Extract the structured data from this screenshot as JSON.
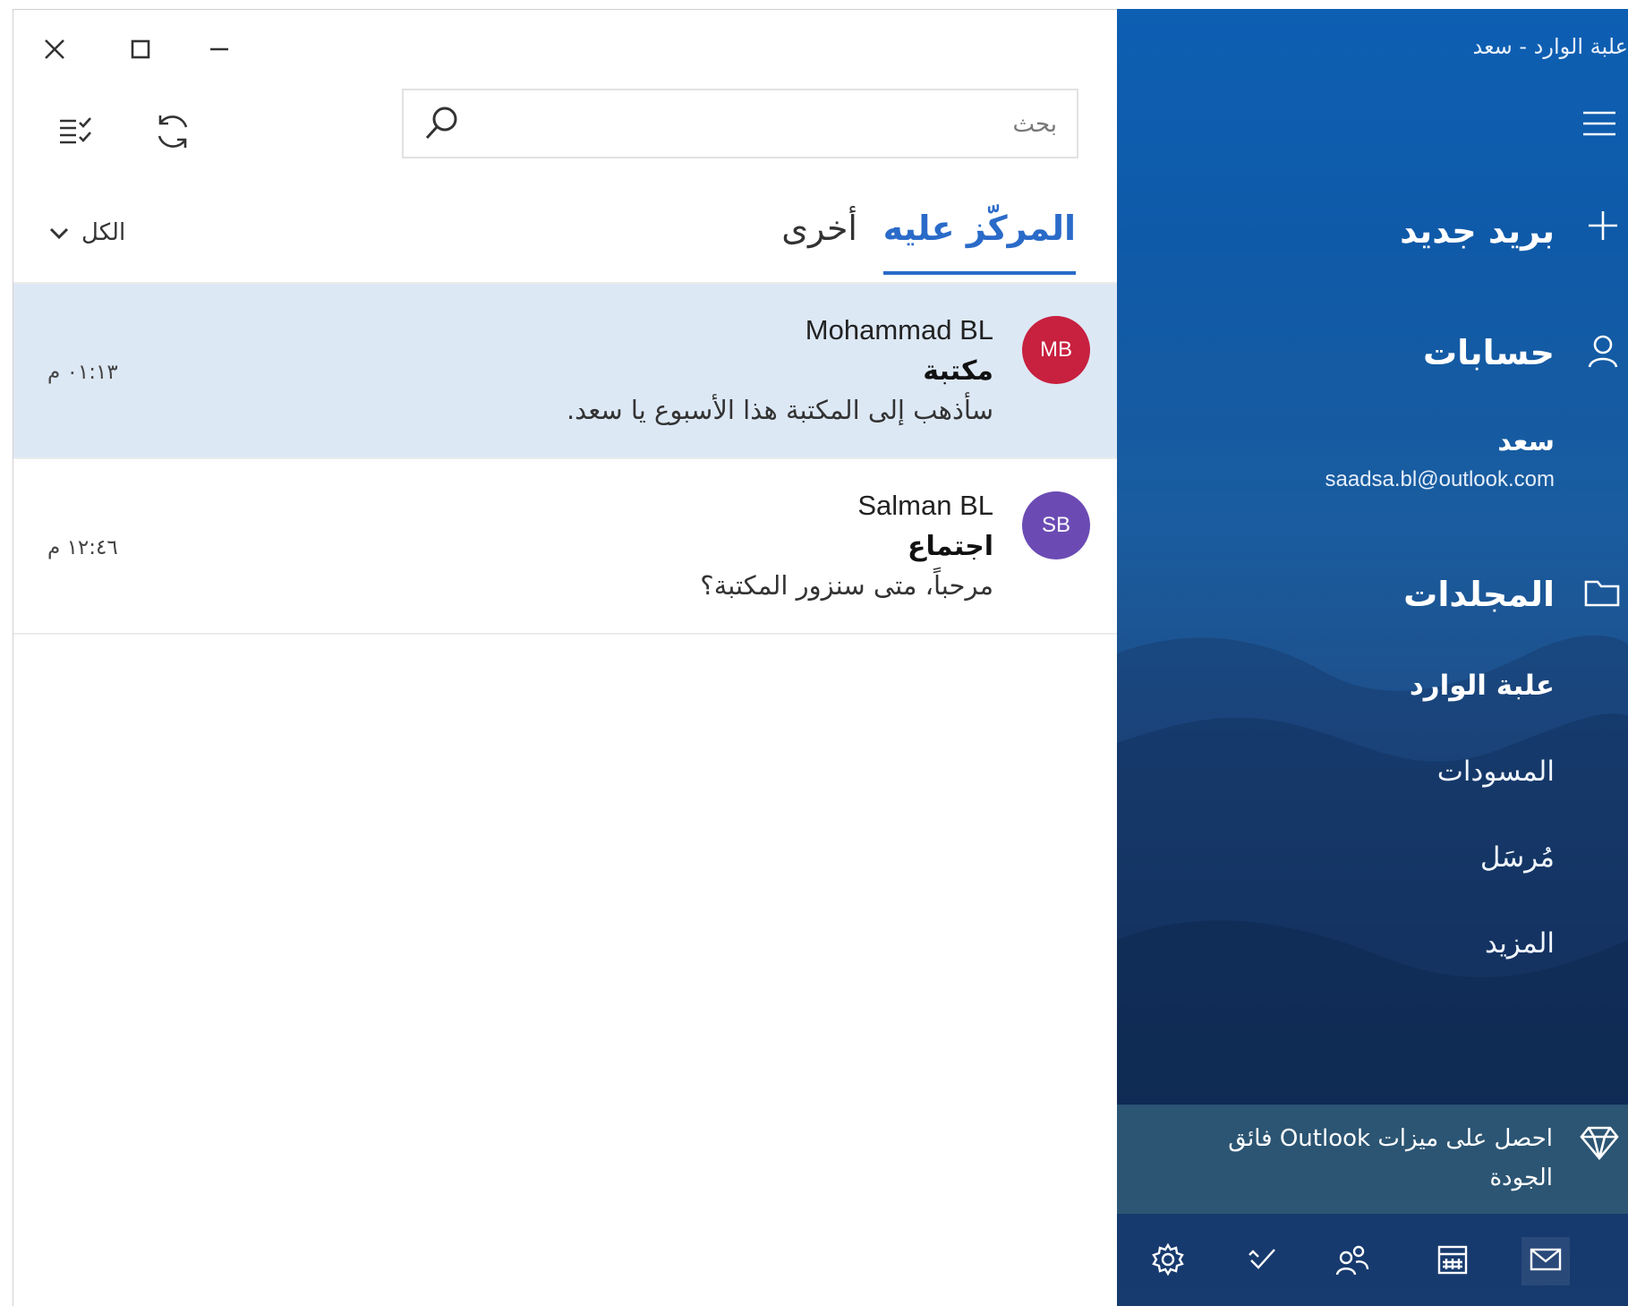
{
  "window": {
    "title": "علبة الوارد - سعد"
  },
  "search": {
    "placeholder": "بحث"
  },
  "tabs": [
    {
      "label": "المركّز عليه",
      "active": true
    },
    {
      "label": "أخرى",
      "active": false
    }
  ],
  "filter": {
    "label": "الكل"
  },
  "messages": [
    {
      "initials": "MB",
      "sender": "Mohammad BL",
      "subject": "مكتبة",
      "preview": "سأذهب إلى المكتبة هذا الأسبوع يا سعد.",
      "time": "٠١:١٣ م",
      "avatar_color": "#c8203f",
      "selected": true
    },
    {
      "initials": "SB",
      "sender": "Salman BL",
      "subject": "اجتماع",
      "preview": "مرحباً، متى سنزور المكتبة؟",
      "time": "١٢:٤٦ م",
      "avatar_color": "#6b4bb3",
      "selected": false
    }
  ],
  "nav": {
    "new_mail": "بريد جديد",
    "accounts_heading": "حسابات",
    "account": {
      "name": "سعد",
      "email": "saadsa.bl@outlook.com"
    },
    "folders_heading": "المجلدات",
    "folders": [
      {
        "label": "علبة الوارد",
        "active": true
      },
      {
        "label": "المسودات",
        "active": false
      },
      {
        "label": "مُرسَل",
        "active": false
      },
      {
        "label": "المزيد",
        "active": false
      }
    ],
    "premium_text": "احصل على ميزات Outlook فائق الجودة"
  },
  "icons": {
    "close": "close-icon",
    "maximize": "maximize-icon",
    "minimize": "minimize-icon",
    "select_mode": "select-mode-icon",
    "sync": "sync-icon",
    "search": "search-icon",
    "chevron": "chevron-down-icon",
    "hamburger": "hamburger-icon",
    "plus": "plus-icon",
    "person": "person-icon",
    "folder": "folder-icon",
    "diamond": "diamond-icon",
    "mail": "mail-icon",
    "calendar": "calendar-icon",
    "people": "people-icon",
    "todo": "todo-icon",
    "settings": "gear-icon"
  },
  "colors": {
    "accent": "#2a6bc9",
    "selected_row": "#dde8f5",
    "nav_blue": "#0f5aa8"
  }
}
